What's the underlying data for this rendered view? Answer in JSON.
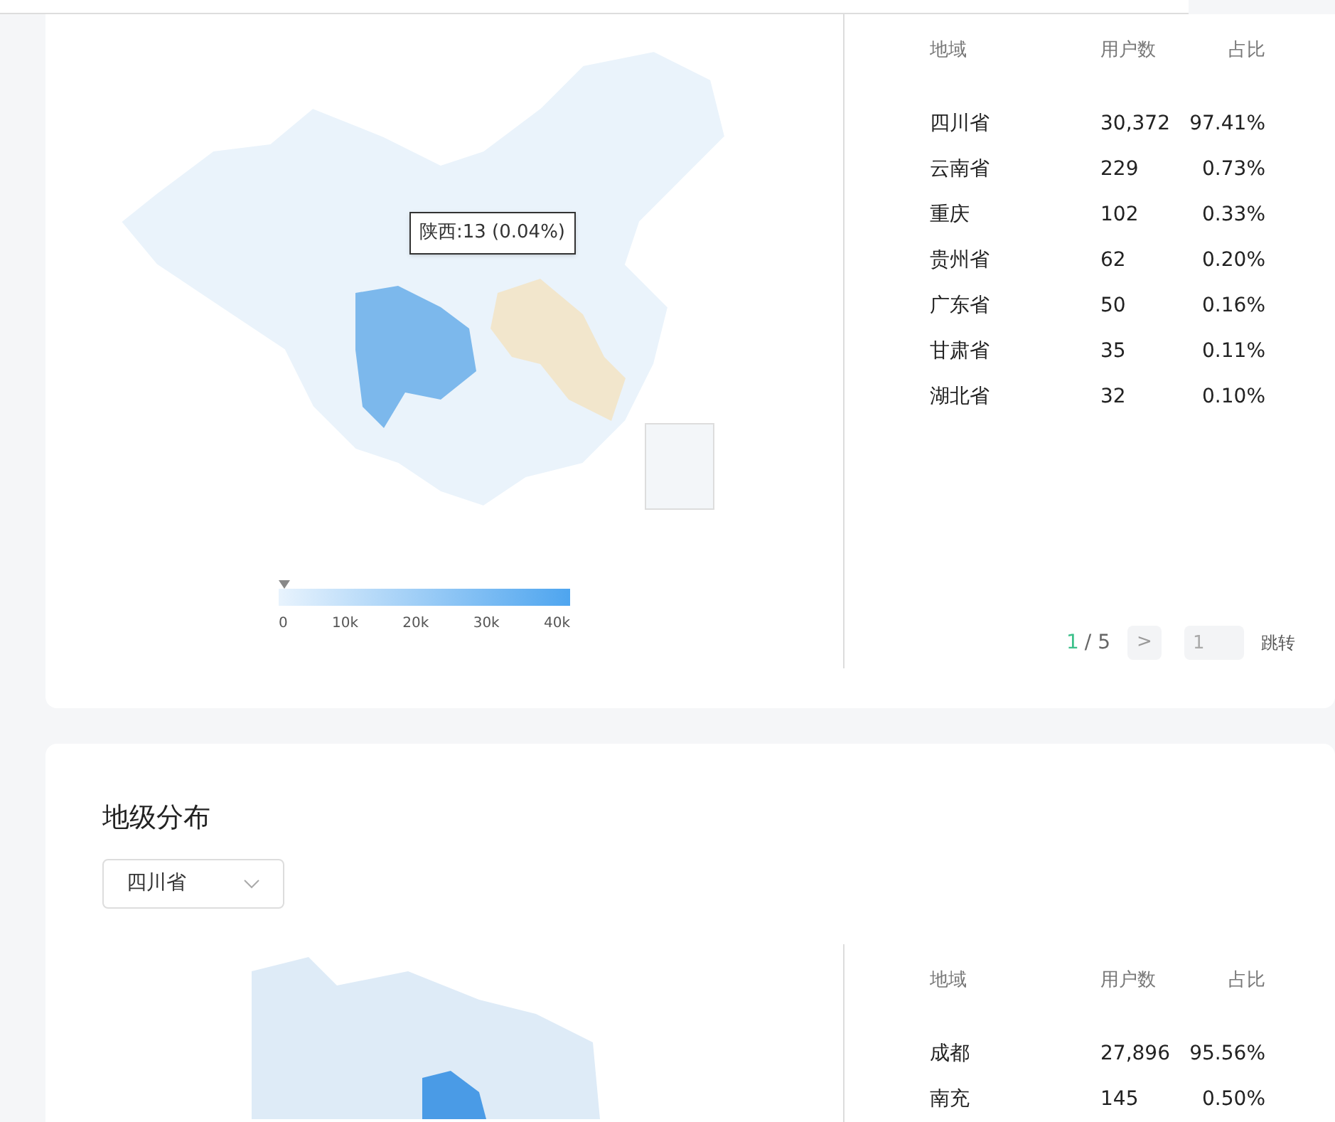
{
  "province_card": {
    "map": {
      "tooltip": "陕西:13 (0.04%)",
      "legend_ticks": [
        "0",
        "10k",
        "20k",
        "30k",
        "40k"
      ]
    },
    "table": {
      "columns": [
        "地域",
        "用户数",
        "占比"
      ],
      "rows": [
        [
          "四川省",
          "30,372",
          "97.41%"
        ],
        [
          "云南省",
          "229",
          "0.73%"
        ],
        [
          "重庆",
          "102",
          "0.33%"
        ],
        [
          "贵州省",
          "62",
          "0.20%"
        ],
        [
          "广东省",
          "50",
          "0.16%"
        ],
        [
          "甘肃省",
          "35",
          "0.11%"
        ],
        [
          "湖北省",
          "32",
          "0.10%"
        ]
      ]
    },
    "pagination": {
      "current": "1",
      "total": "/ 5",
      "next": ">",
      "placeholder": "1",
      "jump_button": "跳转"
    }
  },
  "city_card": {
    "title": "地级分布",
    "select": {
      "value": "四川省"
    },
    "table": {
      "columns": [
        "地域",
        "用户数",
        "占比"
      ],
      "rows": [
        [
          "成都",
          "27,896",
          "95.56%"
        ],
        [
          "南充",
          "145",
          "0.50%"
        ]
      ]
    }
  }
}
